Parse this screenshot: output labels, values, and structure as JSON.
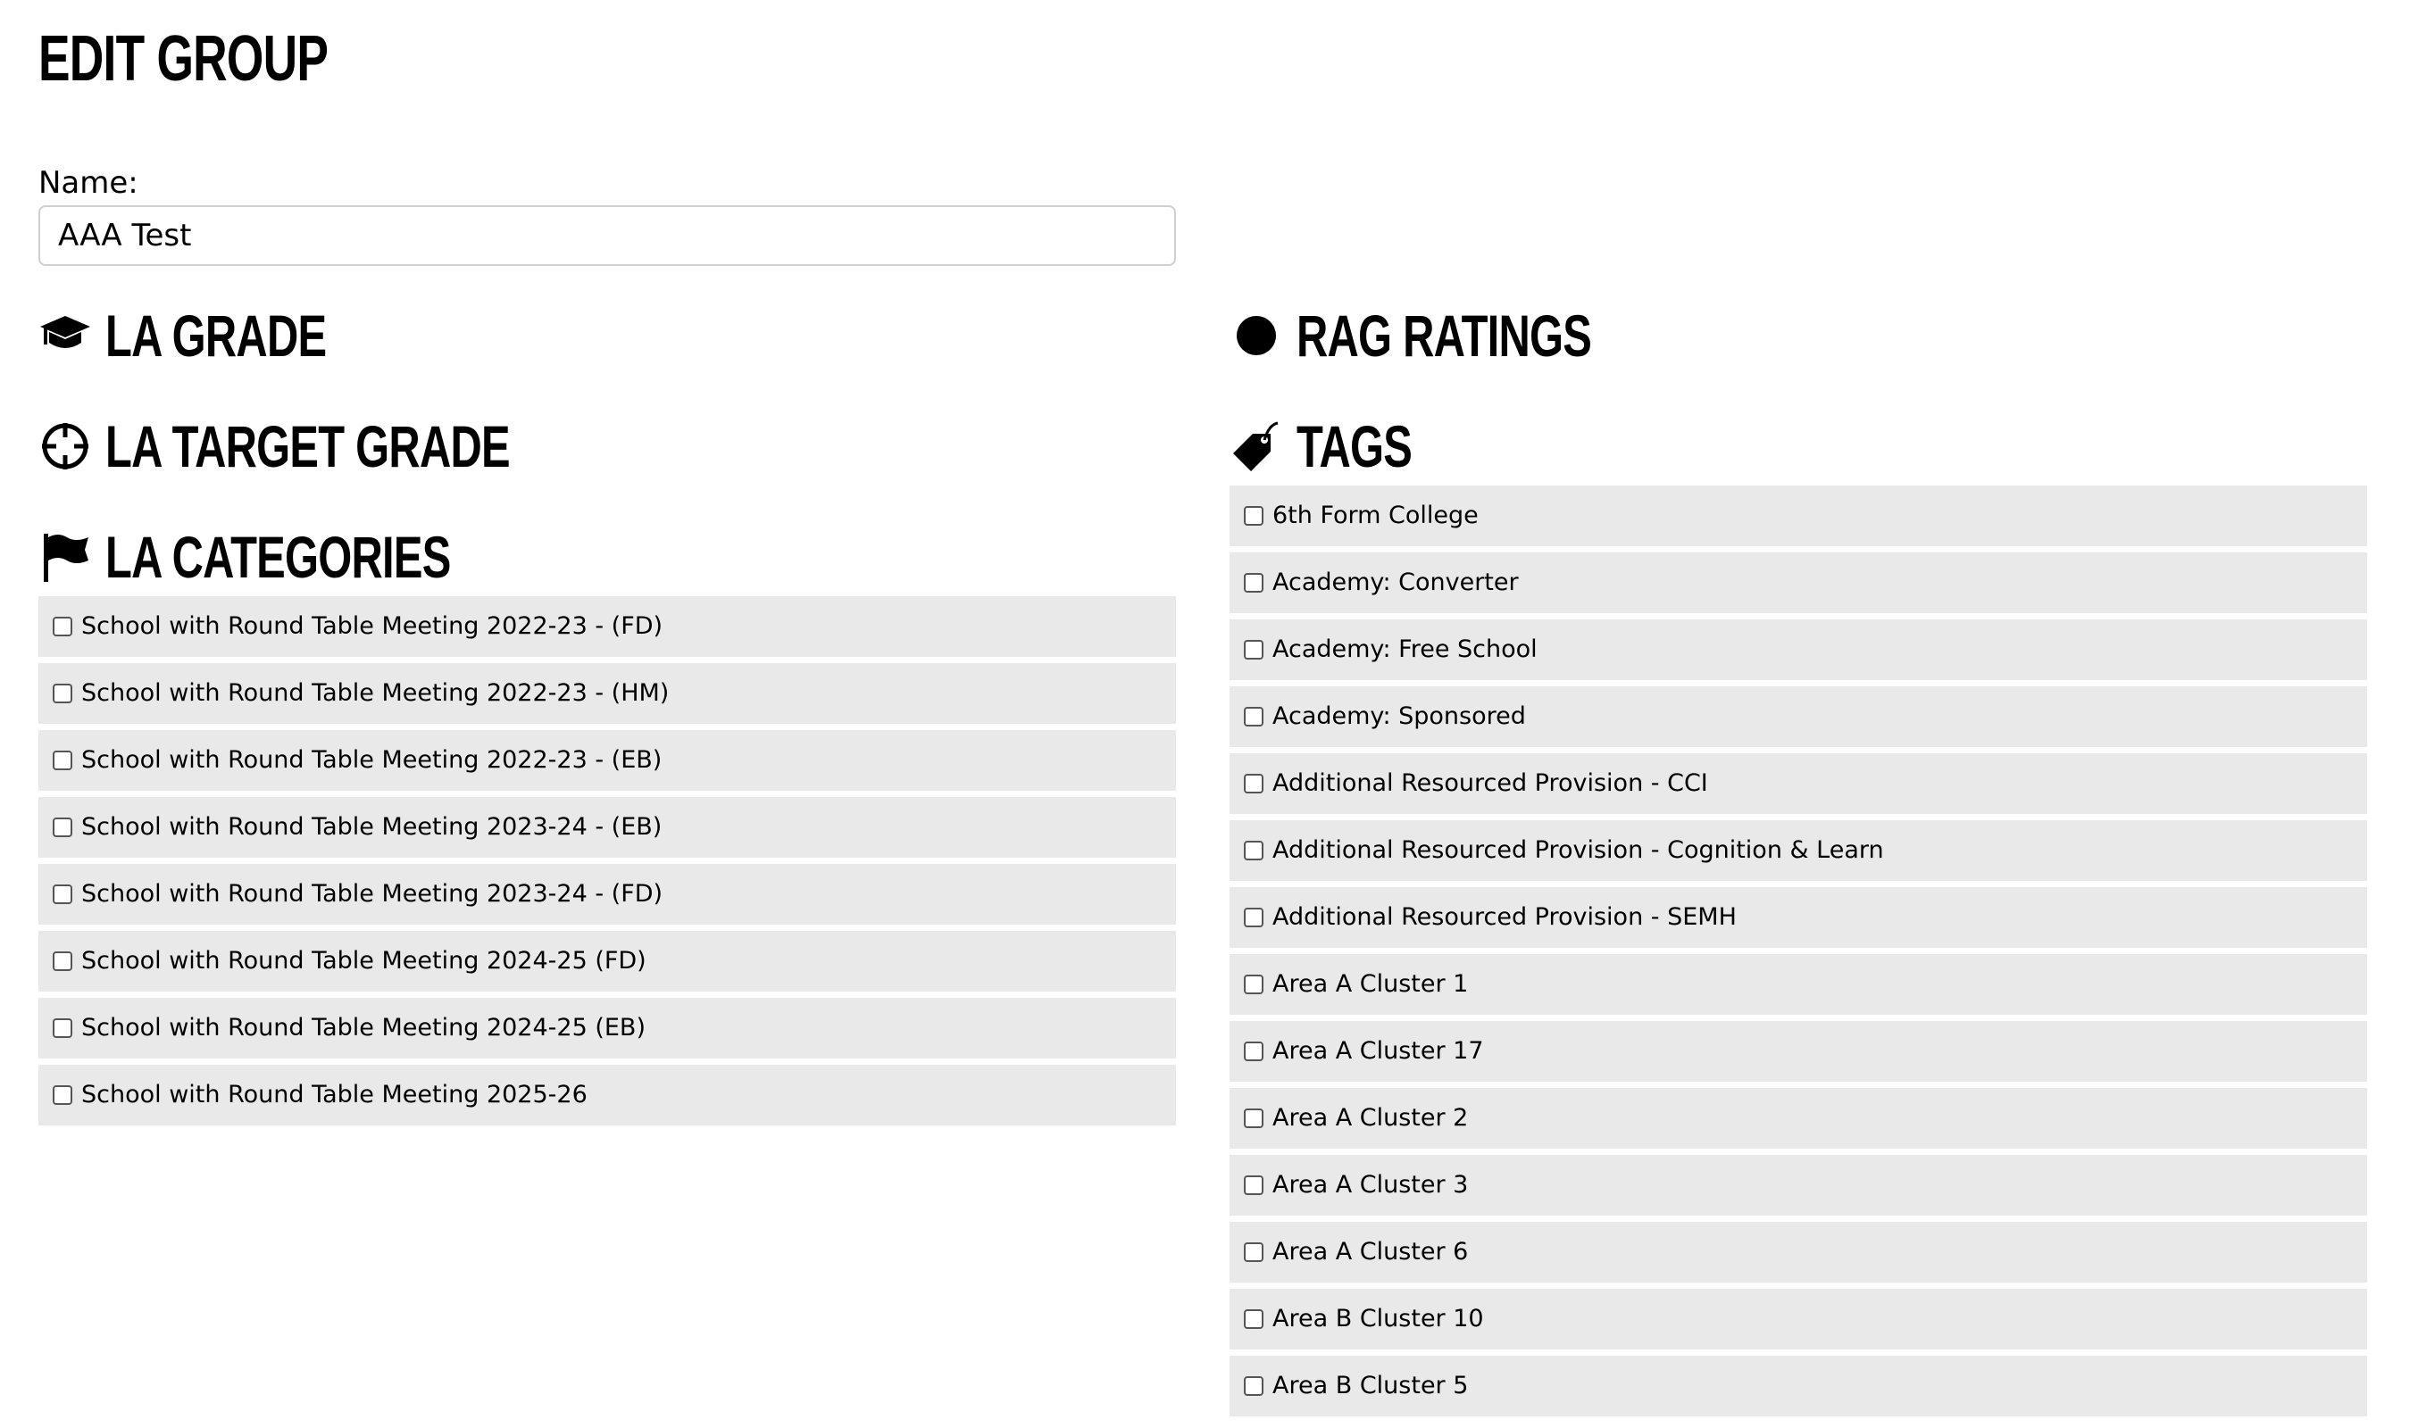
{
  "page": {
    "title": "EDIT GROUP"
  },
  "name_field": {
    "label": "Name:",
    "value": "AAA Test"
  },
  "sections": {
    "la_grade": {
      "title": "LA GRADE",
      "icon": "graduation-cap-icon"
    },
    "la_target_grade": {
      "title": "LA TARGET GRADE",
      "icon": "crosshairs-icon"
    },
    "la_categories": {
      "title": "LA CATEGORIES",
      "icon": "flag-icon",
      "items": [
        "School with Round Table Meeting 2022-23 - (FD)",
        "School with Round Table Meeting 2022-23 - (HM)",
        "School with Round Table Meeting 2022-23 - (EB)",
        "School with Round Table Meeting 2023-24 - (EB)",
        "School with Round Table Meeting 2023-24 - (FD)",
        "School with Round Table Meeting 2024-25 (FD)",
        "School with Round Table Meeting 2024-25 (EB)",
        "School with Round Table Meeting 2025-26"
      ]
    },
    "rag_ratings": {
      "title": "RAG RATINGS",
      "icon": "circle-icon"
    },
    "tags": {
      "title": "TAGS",
      "icon": "tag-icon",
      "items": [
        "6th Form College",
        "Academy: Converter",
        "Academy: Free School",
        "Academy: Sponsored",
        "Additional Resourced Provision - CCI",
        "Additional Resourced Provision - Cognition & Learn",
        "Additional Resourced Provision - SEMH",
        "Area A Cluster 1",
        "Area A Cluster 17",
        "Area A Cluster 2",
        "Area A Cluster 3",
        "Area A Cluster 6",
        "Area B Cluster 10",
        "Area B Cluster 5"
      ]
    }
  }
}
